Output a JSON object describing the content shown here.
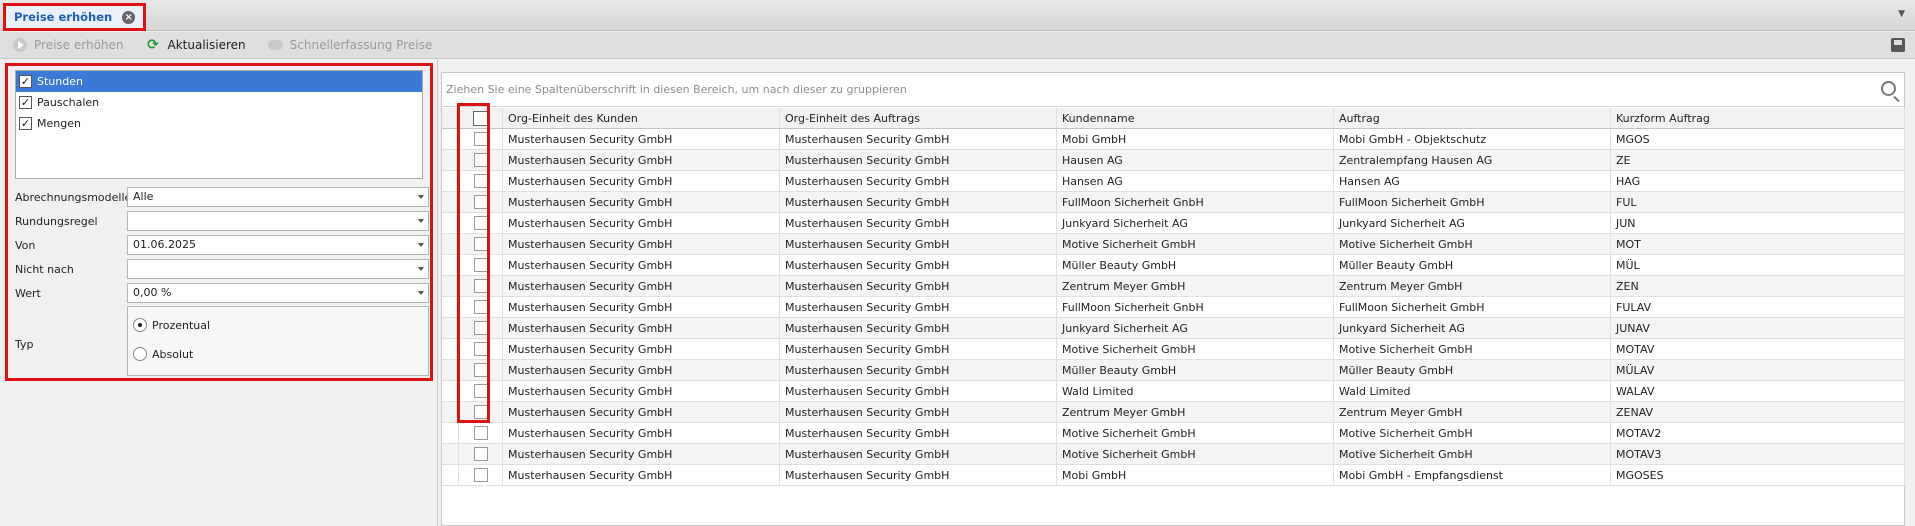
{
  "tab": {
    "label": "Preise erhöhen"
  },
  "toolbar": {
    "raise_prices": "Preise erhöhen",
    "refresh": "Aktualisieren",
    "quick_entry": "Schnellerfassung Preise"
  },
  "filter": {
    "items": [
      {
        "label": "Stunden",
        "checked": true,
        "selected": true
      },
      {
        "label": "Pauschalen",
        "checked": true,
        "selected": false
      },
      {
        "label": "Mengen",
        "checked": true,
        "selected": false
      }
    ],
    "abrechnungsmodelle_label": "Abrechnungsmodelle",
    "abrechnungsmodelle_value": "Alle",
    "rundungsregel_label": "Rundungsregel",
    "rundungsregel_value": "",
    "von_label": "Von",
    "von_value": "01.06.2025",
    "nicht_nach_label": "Nicht nach",
    "nicht_nach_value": "",
    "wert_label": "Wert",
    "wert_value": "0,00 %",
    "typ_label": "Typ",
    "typ_options": [
      "Prozentual",
      "Absolut"
    ],
    "typ_selected": "Prozentual"
  },
  "grid": {
    "group_hint": "Ziehen Sie eine Spaltenüberschrift in diesen Bereich, um nach dieser zu gruppieren",
    "columns": [
      "Org-Einheit des Kunden",
      "Org-Einheit des Auftrags",
      "Kundenname",
      "Auftrag",
      "Kurzform Auftrag"
    ],
    "rows": [
      [
        "Musterhausen Security GmbH",
        "Musterhausen Security GmbH",
        "Mobi GmbH",
        "Mobi GmbH - Objektschutz",
        "MGOS"
      ],
      [
        "Musterhausen Security GmbH",
        "Musterhausen Security GmbH",
        "Hausen AG",
        "Zentralempfang Hausen AG",
        "ZE"
      ],
      [
        "Musterhausen Security GmbH",
        "Musterhausen Security GmbH",
        "Hansen AG",
        "Hansen AG",
        "HAG"
      ],
      [
        "Musterhausen Security GmbH",
        "Musterhausen Security GmbH",
        "FullMoon Sicherheit GnbH",
        "FullMoon Sicherheit GmbH",
        "FUL"
      ],
      [
        "Musterhausen Security GmbH",
        "Musterhausen Security GmbH",
        "Junkyard Sicherheit AG",
        "Junkyard Sicherheit AG",
        "JUN"
      ],
      [
        "Musterhausen Security GmbH",
        "Musterhausen Security GmbH",
        "Motive Sicherheit GmbH",
        "Motive Sicherheit GmbH",
        "MOT"
      ],
      [
        "Musterhausen Security GmbH",
        "Musterhausen Security GmbH",
        "Müller Beauty GmbH",
        "Müller Beauty GmbH",
        "MÜL"
      ],
      [
        "Musterhausen Security GmbH",
        "Musterhausen Security GmbH",
        "Zentrum Meyer GmbH",
        "Zentrum Meyer GmbH",
        "ZEN"
      ],
      [
        "Musterhausen Security GmbH",
        "Musterhausen Security GmbH",
        "FullMoon Sicherheit GnbH",
        "FullMoon Sicherheit GmbH",
        "FULAV"
      ],
      [
        "Musterhausen Security GmbH",
        "Musterhausen Security GmbH",
        "Junkyard Sicherheit AG",
        "Junkyard Sicherheit AG",
        "JUNAV"
      ],
      [
        "Musterhausen Security GmbH",
        "Musterhausen Security GmbH",
        "Motive Sicherheit GmbH",
        "Motive Sicherheit GmbH",
        "MOTAV"
      ],
      [
        "Musterhausen Security GmbH",
        "Musterhausen Security GmbH",
        "Müller Beauty GmbH",
        "Müller Beauty GmbH",
        "MÜLAV"
      ],
      [
        "Musterhausen Security GmbH",
        "Musterhausen Security GmbH",
        "Wald Limited",
        "Wald Limited",
        "WALAV"
      ],
      [
        "Musterhausen Security GmbH",
        "Musterhausen Security GmbH",
        "Zentrum Meyer GmbH",
        "Zentrum Meyer GmbH",
        "ZENAV"
      ],
      [
        "Musterhausen Security GmbH",
        "Musterhausen Security GmbH",
        "Motive Sicherheit GmbH",
        "Motive Sicherheit GmbH",
        "MOTAV2"
      ],
      [
        "Musterhausen Security GmbH",
        "Musterhausen Security GmbH",
        "Motive Sicherheit GmbH",
        "Motive Sicherheit GmbH",
        "MOTAV3"
      ],
      [
        "Musterhausen Security GmbH",
        "Musterhausen Security GmbH",
        "Mobi GmbH",
        "Mobi GmbH - Empfangsdienst",
        "MGOSES"
      ]
    ]
  },
  "colors": {
    "accent": "#3b78d8",
    "highlight": "#dd1111",
    "tab_text": "#1f5fb3"
  }
}
